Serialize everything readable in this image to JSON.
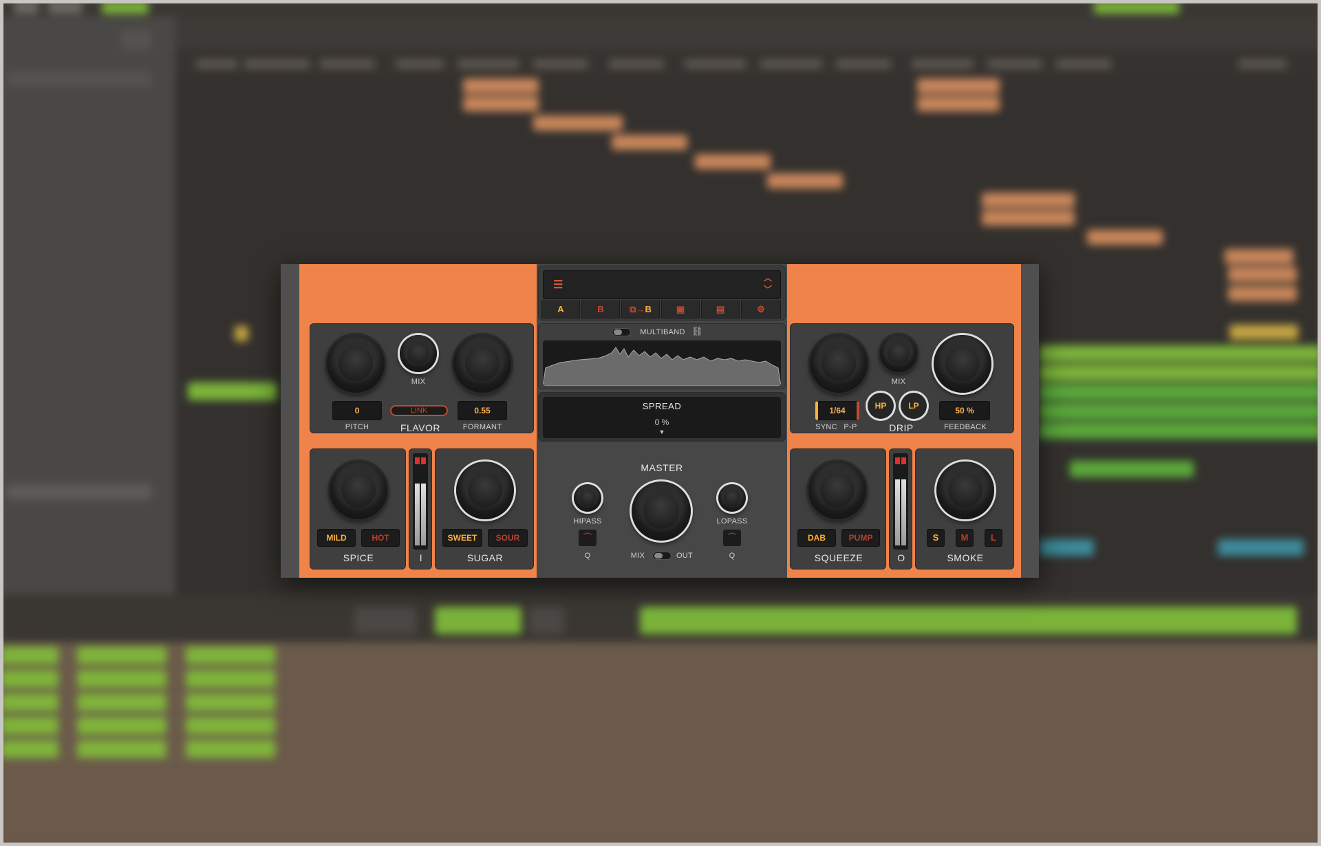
{
  "plugin": {
    "preset_bar": {
      "menu_icon": "hamburger-icon",
      "arrows_icon": "up-down-chevron-icon",
      "preset_name": ""
    },
    "tabs": [
      {
        "label": "A",
        "icon": "",
        "active": true
      },
      {
        "label": "B",
        "icon": "",
        "active": false
      },
      {
        "label": "B",
        "icon": "copy-a-to-b-icon",
        "active": true
      },
      {
        "label": "",
        "icon": "calendar-icon",
        "active": false
      },
      {
        "label": "",
        "icon": "calendar-icon",
        "active": false
      },
      {
        "label": "",
        "icon": "gear-icon",
        "active": false
      }
    ],
    "flavor": {
      "title": "FLAVOR",
      "pitch_label": "PITCH",
      "pitch_value": "0",
      "mix_label": "MIX",
      "link_label": "LINK",
      "formant_label": "FORMANT",
      "formant_value": "0.55"
    },
    "multiband": {
      "label": "MULTIBAND"
    },
    "spread": {
      "label": "SPREAD",
      "value": "0 %"
    },
    "drip": {
      "title": "DRIP",
      "mix_label": "MIX",
      "time_value": "1/64",
      "sync_label": "SYNC",
      "pp_label": "P-P",
      "hp_label": "HP",
      "lp_label": "LP",
      "feedback_value": "50 %",
      "feedback_label": "FEEDBACK"
    },
    "spice": {
      "title": "SPICE",
      "mild": "MILD",
      "hot": "HOT"
    },
    "input_meter": {
      "label": "I",
      "level": 0.75
    },
    "sugar": {
      "title": "SUGAR",
      "sweet": "SWEET",
      "sour": "SOUR"
    },
    "master": {
      "title": "MASTER",
      "hipass_label": "HIPASS",
      "lopass_label": "LOPASS",
      "q_left": "Q",
      "q_right": "Q",
      "mix_label": "MIX",
      "out_label": "OUT"
    },
    "squeeze": {
      "title": "SQUEEZE",
      "dab": "DAB",
      "pump": "PUMP"
    },
    "output_meter": {
      "label": "O",
      "level": 0.8
    },
    "smoke": {
      "title": "SMOKE",
      "s": "S",
      "m": "M",
      "l": "L"
    }
  },
  "colors": {
    "accent": "#f0834a",
    "lcd_on": "#ffb03c",
    "lcd_off": "#b8402a",
    "panel": "#3f3f3f"
  }
}
